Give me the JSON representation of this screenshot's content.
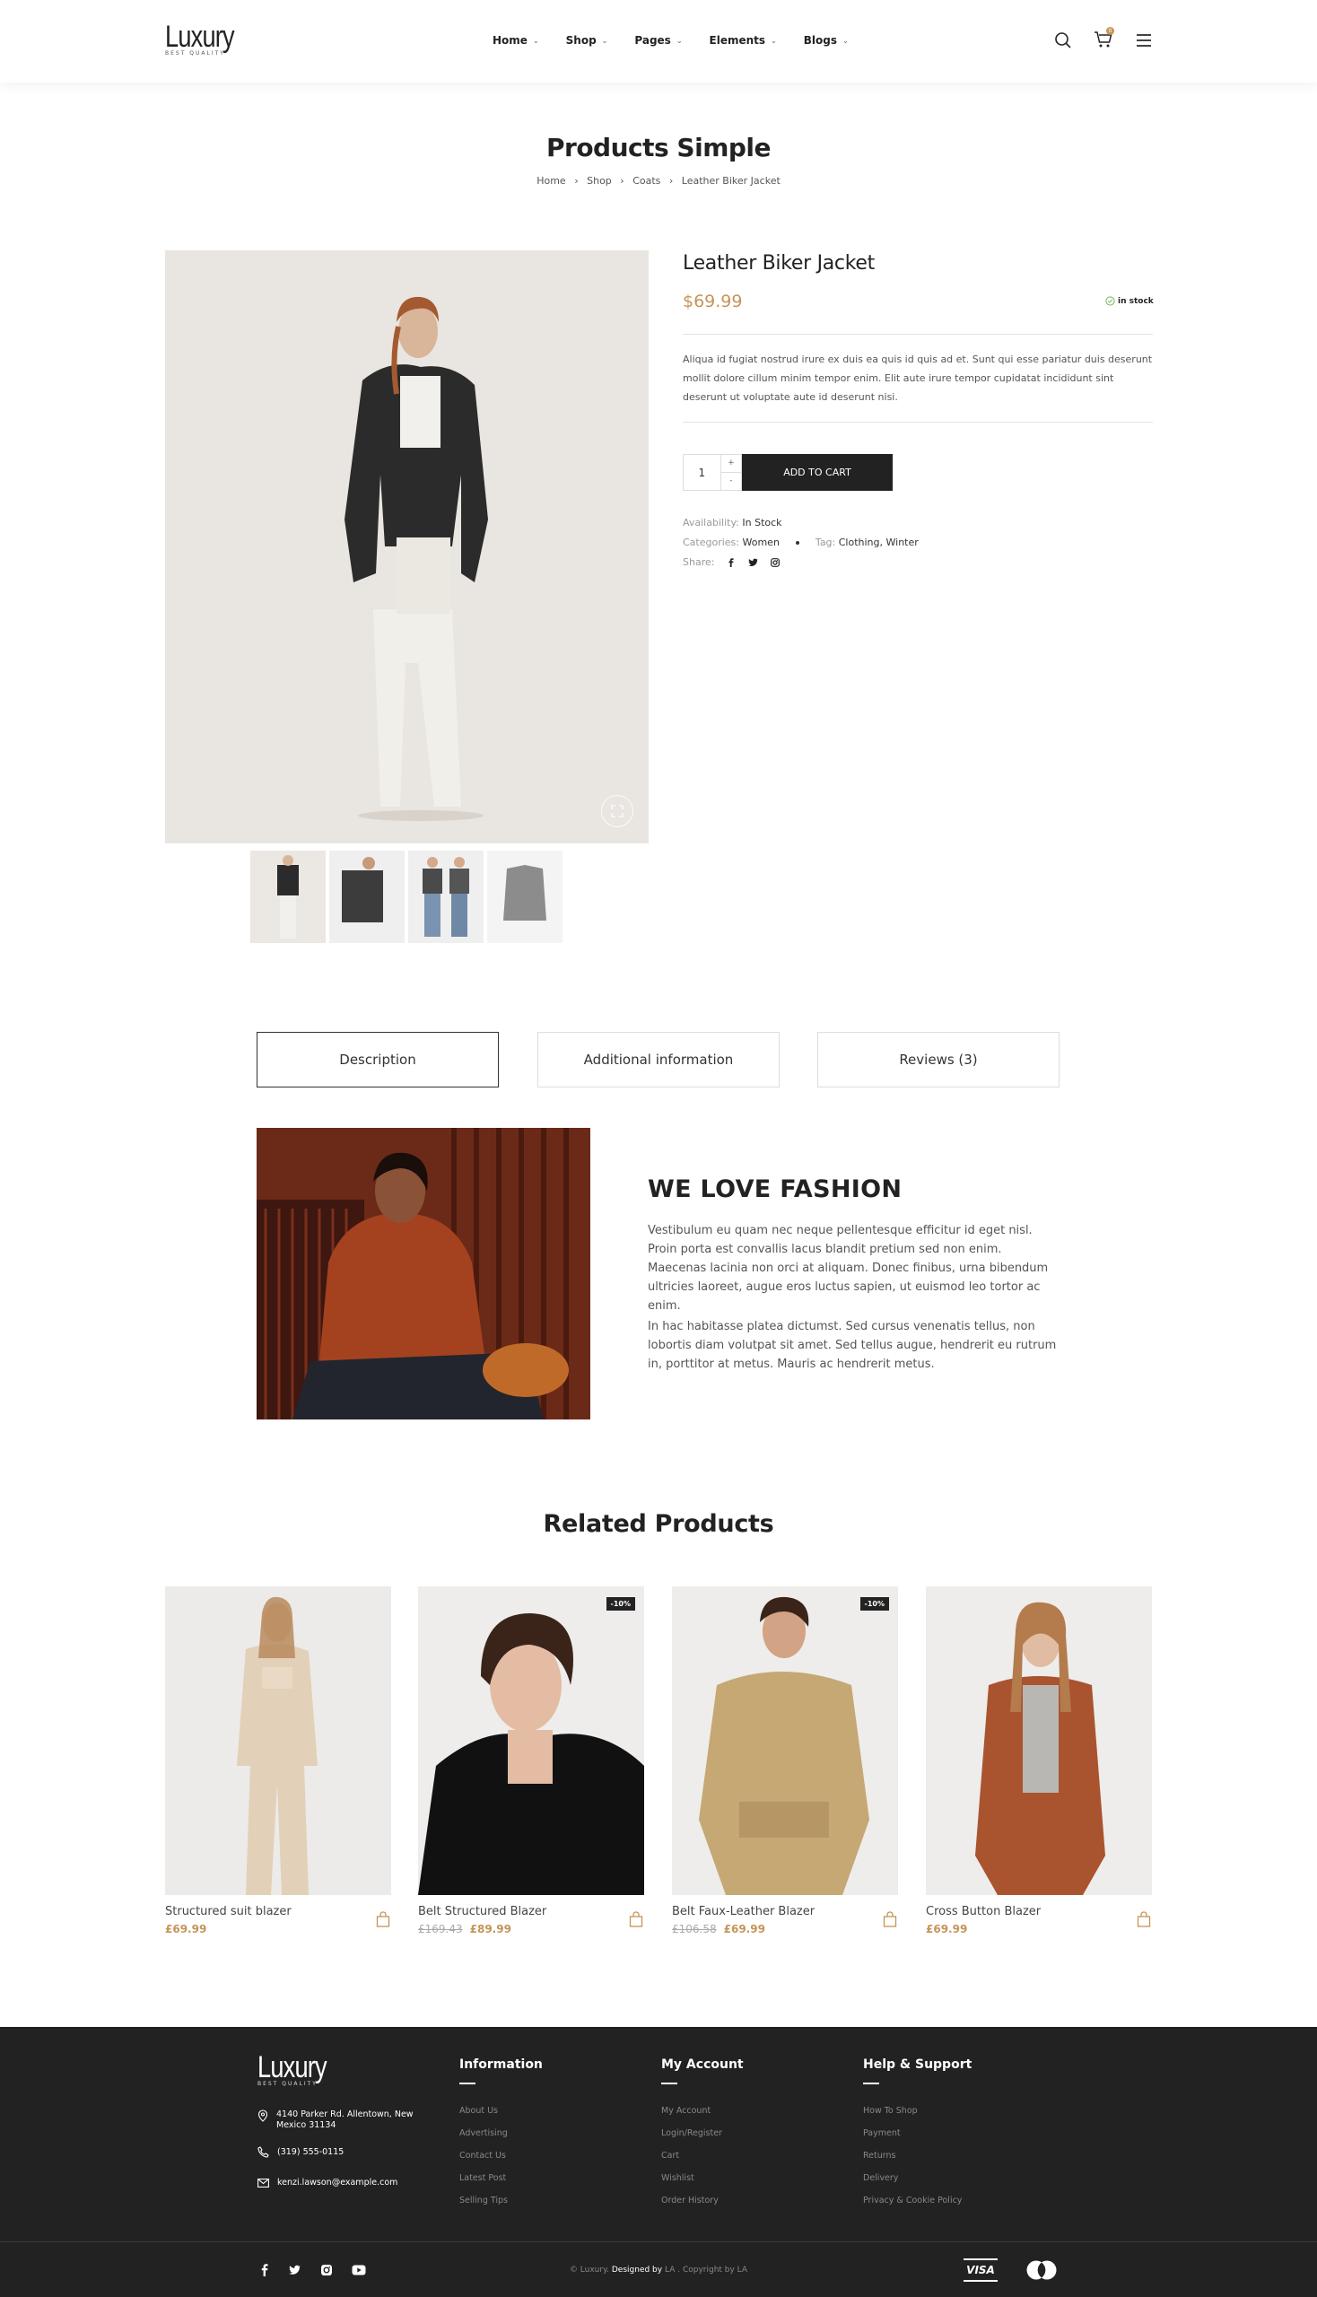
{
  "header": {
    "logo": "Luxury",
    "logo_sub": "BEST QUALITY",
    "nav": [
      "Home",
      "Shop",
      "Pages",
      "Elements",
      "Blogs"
    ],
    "cart_count": "0"
  },
  "page": {
    "title": "Products Simple",
    "breadcrumb": [
      "Home",
      "Shop",
      "Coats",
      "Leather Biker Jacket"
    ]
  },
  "product": {
    "name": "Leather Biker Jacket",
    "price": "$69.99",
    "stock": "in stock",
    "description": "Aliqua id fugiat nostrud irure ex duis ea quis id quis ad et. Sunt qui esse pariatur duis deserunt mollit dolore cillum minim tempor enim. Elit aute irure tempor cupidatat incididunt sint deserunt ut voluptate aute id deserunt nisi.",
    "qty": "1",
    "add_to_cart": "ADD TO CART",
    "availability_label": "Availability:",
    "availability_value": "In Stock",
    "categories_label": "Categories:",
    "categories_value": "Women",
    "tag_label": "Tag:",
    "tag_value": "Clothing, Winter",
    "share_label": "Share:"
  },
  "tabs": [
    "Description",
    "Additional information",
    "Reviews (3)"
  ],
  "fashion": {
    "title": "WE LOVE FASHION",
    "p1": "Vestibulum eu quam nec neque pellentesque efficitur id eget nisl. Proin porta est convallis lacus blandit pretium sed non enim. Maecenas lacinia non orci at aliquam. Donec finibus, urna bibendum ultricies laoreet, augue eros luctus sapien, ut euismod leo tortor ac enim.",
    "p2": "In hac habitasse platea dictumst. Sed cursus venenatis tellus, non lobortis diam volutpat sit amet. Sed tellus augue, hendrerit eu rutrum in, porttitor at metus. Mauris ac hendrerit metus."
  },
  "related": {
    "title": "Related Products",
    "items": [
      {
        "name": "Structured suit blazer",
        "old": "",
        "price": "£69.99",
        "badge": ""
      },
      {
        "name": "Belt Structured Blazer",
        "old": "£169.43",
        "price": "£89.99",
        "badge": "-10%"
      },
      {
        "name": "Belt Faux-Leather Blazer",
        "old": "£106.58",
        "price": "£69.99",
        "badge": "-10%"
      },
      {
        "name": "Cross Button Blazer",
        "old": "",
        "price": "£69.99",
        "badge": ""
      }
    ]
  },
  "footer": {
    "logo": "Luxury",
    "logo_sub": "BEST QUALITY",
    "address": "4140 Parker Rd. Allentown, New Mexico 31134",
    "phone": "(319) 555-0115",
    "email": "kenzi.lawson@example.com",
    "col1_title": "Information",
    "col1": [
      "About Us",
      "Advertising",
      "Contact Us",
      "Latest Post",
      "Selling Tips"
    ],
    "col2_title": "My Account",
    "col2": [
      "My Account",
      "Login/Register",
      "Cart",
      "Wishlist",
      "Order History"
    ],
    "col3_title": "Help & Support",
    "col3": [
      "How To Shop",
      "Payment",
      "Returns",
      "Delivery",
      "Privacy & Cookie Policy"
    ],
    "copyright_pre": "© Luxury.",
    "copyright_designed": "Designed by",
    "copyright_post": "LA . Copyright by LA",
    "payments": [
      "VISA"
    ]
  },
  "colors": {
    "accent": "#c59458",
    "dark": "#222222",
    "footer_bg": "#222222"
  }
}
